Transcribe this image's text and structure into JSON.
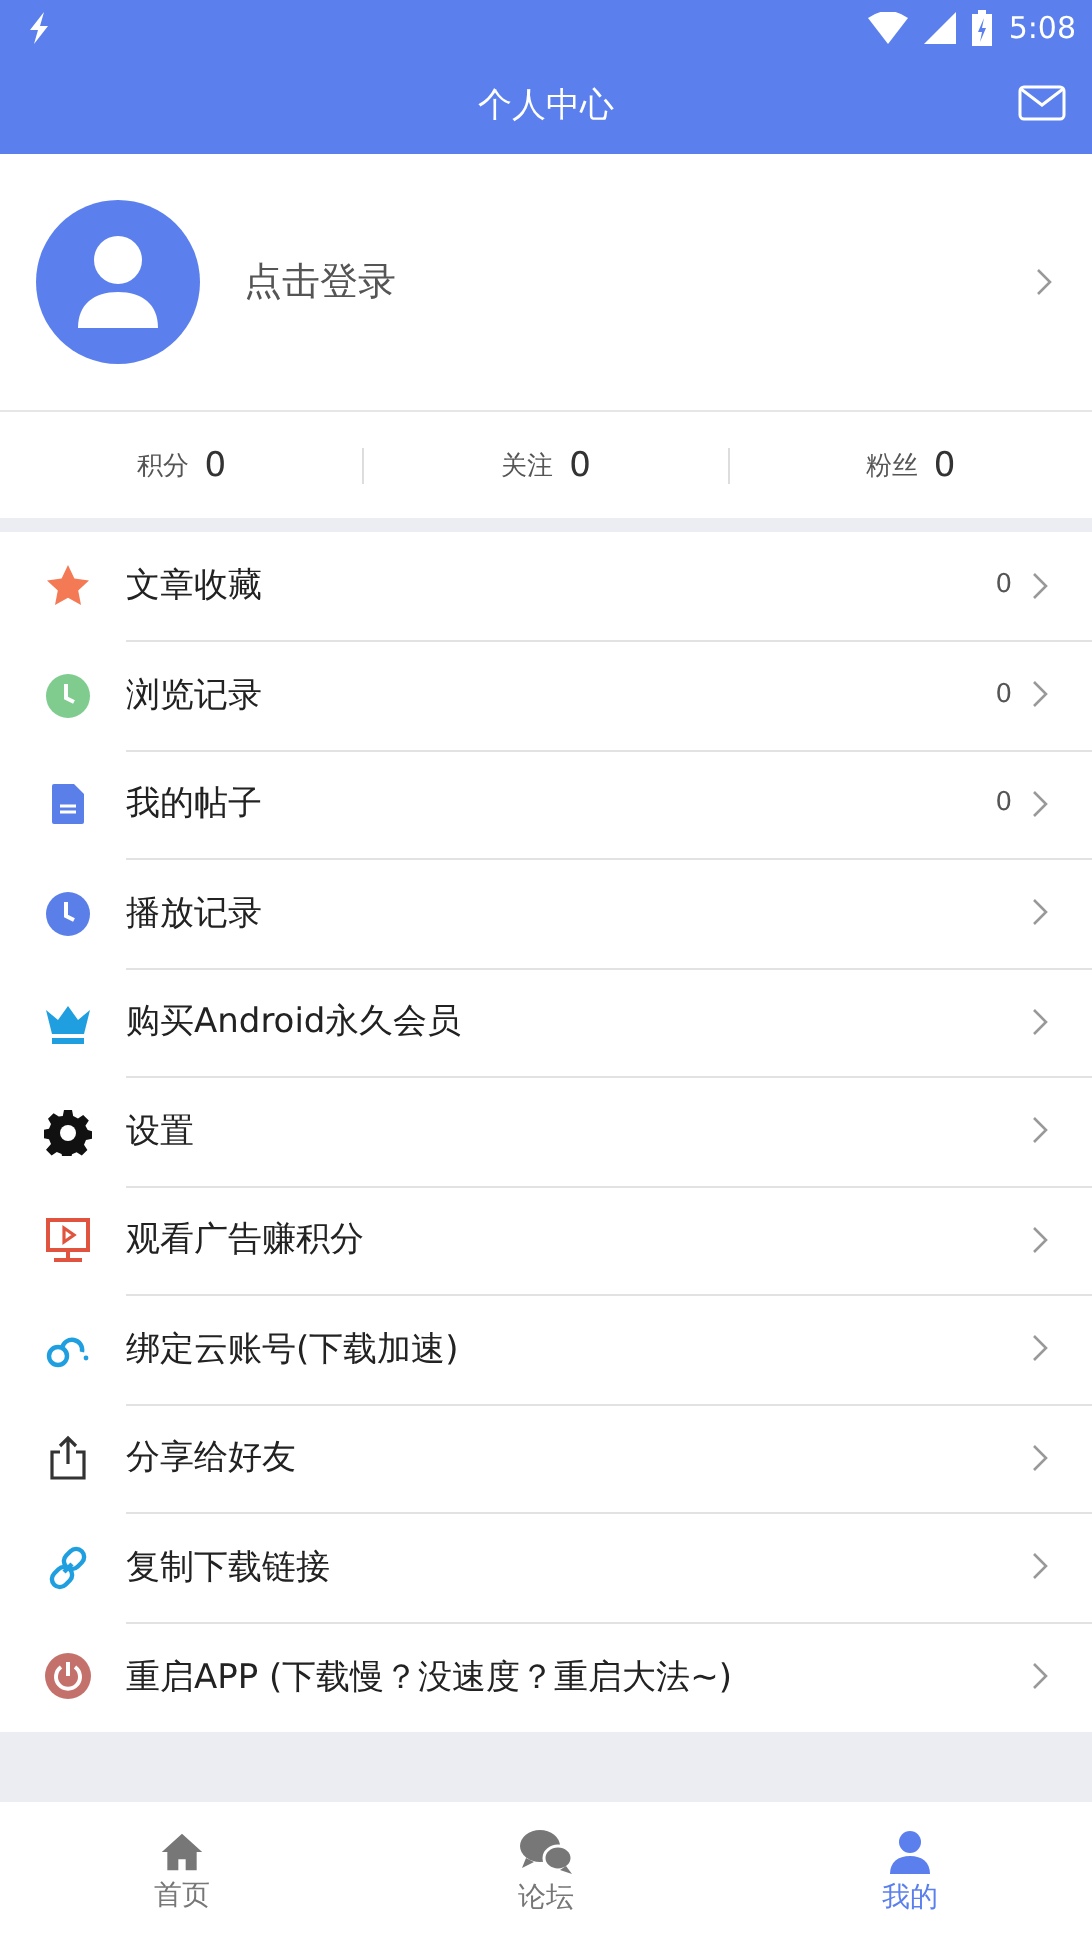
{
  "status_bar": {
    "time": "5:08"
  },
  "header": {
    "title": "个人中心"
  },
  "profile": {
    "login_label": "点击登录"
  },
  "stats": [
    {
      "label": "积分",
      "value": "0"
    },
    {
      "label": "关注",
      "value": "0"
    },
    {
      "label": "粉丝",
      "value": "0"
    }
  ],
  "menu": [
    {
      "label": "文章收藏",
      "count": "0"
    },
    {
      "label": "浏览记录",
      "count": "0"
    },
    {
      "label": "我的帖子",
      "count": "0"
    },
    {
      "label": "播放记录"
    },
    {
      "label": "购买Android永久会员"
    },
    {
      "label": "设置"
    },
    {
      "label": "观看广告赚积分"
    },
    {
      "label": "绑定云账号(下载加速)"
    },
    {
      "label": "分享给好友"
    },
    {
      "label": "复制下载链接"
    },
    {
      "label": "重启APP (下载慢？没速度？重启大法~)"
    }
  ],
  "tabs": [
    {
      "label": "首页",
      "selected": false
    },
    {
      "label": "论坛",
      "selected": false
    },
    {
      "label": "我的",
      "selected": true
    }
  ]
}
